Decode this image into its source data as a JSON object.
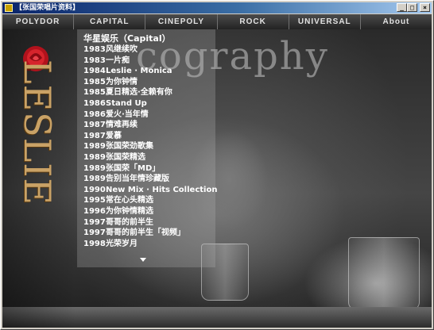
{
  "window": {
    "title": "【张国荣唱片资料】",
    "controls": {
      "minimize": "_",
      "maximize": "□",
      "close": "×"
    }
  },
  "nav": {
    "tabs": [
      {
        "label": "POLYDOR"
      },
      {
        "label": "CAPITAL"
      },
      {
        "label": "CINEPOLY"
      },
      {
        "label": "ROCK"
      },
      {
        "label": "UNIVERSAL"
      },
      {
        "label": "About"
      }
    ]
  },
  "banner": {
    "title_fragment": "cography"
  },
  "logo": {
    "text": "LESLIE"
  },
  "discography": {
    "header": "华星娱乐（Capital）",
    "albums": [
      {
        "year": "1983",
        "title": "风继续吹"
      },
      {
        "year": "1983",
        "title": "一片痴"
      },
      {
        "year": "1984",
        "title": "Leslie · Monica"
      },
      {
        "year": "1985",
        "title": "为你钟情"
      },
      {
        "year": "1985",
        "title": "夏日精选·全赖有你"
      },
      {
        "year": "1986",
        "title": "Stand Up"
      },
      {
        "year": "1986",
        "title": "爱火·当年情"
      },
      {
        "year": "1987",
        "title": "情难再续"
      },
      {
        "year": "1987",
        "title": "爱慕"
      },
      {
        "year": "1989",
        "title": "张国荣劲歌集"
      },
      {
        "year": "1989",
        "title": "张国荣精选"
      },
      {
        "year": "1989",
        "title": "张国荣「MD」"
      },
      {
        "year": "1989",
        "title": "告别当年情珍藏版"
      },
      {
        "year": "1990",
        "title": "New Mix · Hits Collection"
      },
      {
        "year": "1995",
        "title": "常在心头精选"
      },
      {
        "year": "1996",
        "title": "为你钟情精选"
      },
      {
        "year": "1997",
        "title": "哥哥的前半生"
      },
      {
        "year": "1997",
        "title": "哥哥的前半生「视频」"
      },
      {
        "year": "1998",
        "title": "光荣岁月"
      }
    ]
  }
}
